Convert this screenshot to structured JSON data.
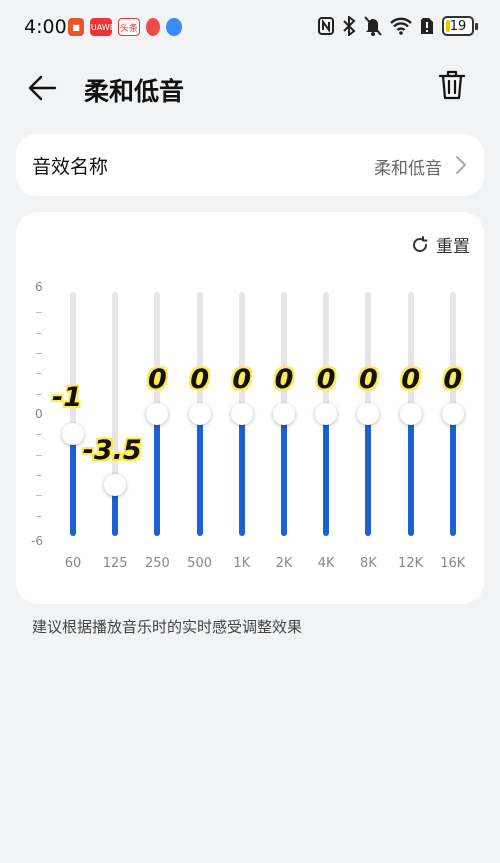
{
  "status_bar": {
    "time": "4:00",
    "apps": [
      "HUAWEI",
      "头条"
    ],
    "battery": "19"
  },
  "header": {
    "title": "柔和低音",
    "back_icon": "arrow-left-icon",
    "delete_icon": "trash-icon"
  },
  "preset": {
    "label": "音效名称",
    "value": "柔和低音"
  },
  "equalizer": {
    "reset_label": "重置",
    "scale_top": "6",
    "scale_mid": "0",
    "scale_bottom": "-6",
    "range": [
      -6,
      6
    ],
    "bands": [
      {
        "label": "60",
        "value": -1,
        "value_text": "-1"
      },
      {
        "label": "125",
        "value": -3.5,
        "value_text": "-3.5"
      },
      {
        "label": "250",
        "value": 0,
        "value_text": "0"
      },
      {
        "label": "500",
        "value": 0,
        "value_text": "0"
      },
      {
        "label": "1K",
        "value": 0,
        "value_text": "0"
      },
      {
        "label": "2K",
        "value": 0,
        "value_text": "0"
      },
      {
        "label": "4K",
        "value": 0,
        "value_text": "0"
      },
      {
        "label": "8K",
        "value": 0,
        "value_text": "0"
      },
      {
        "label": "12K",
        "value": 0,
        "value_text": "0"
      },
      {
        "label": "16K",
        "value": 0,
        "value_text": "0"
      }
    ],
    "accent_color": "#1f5fd6"
  },
  "hint": "建议根据播放音乐时的实时感受调整效果"
}
